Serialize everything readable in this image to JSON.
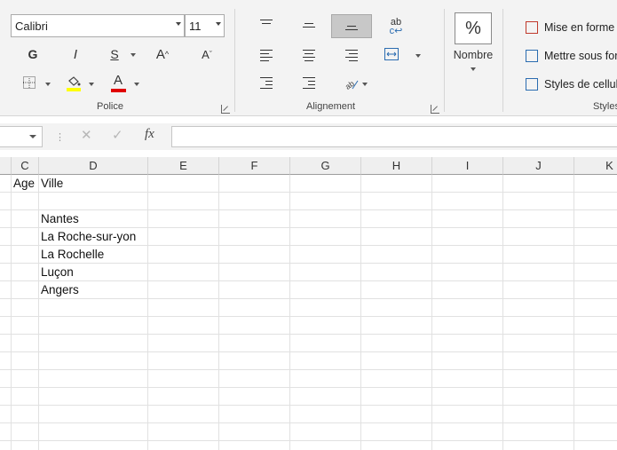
{
  "ribbon": {
    "font": {
      "name": "Calibri",
      "size": "11"
    },
    "police": {
      "group_label": "Police",
      "bold": "G",
      "italic": "I",
      "underline": "S",
      "grow": "A",
      "shrink": "A",
      "font_color_letter": "A",
      "highlight_color": "#ffff00",
      "font_color": "#e00000"
    },
    "alignment": {
      "group_label": "Alignement",
      "wrap_glyph": "ab"
    },
    "number": {
      "percent": "%",
      "label": "Nombre"
    },
    "styles": {
      "conditional": "Mise en forme",
      "as_table": "Mettre sous for",
      "cell_styles": "Styles de cellule",
      "group_label": "Styles"
    }
  },
  "formula_bar": {
    "cancel": "✕",
    "enter": "✓",
    "fx": "fx",
    "content": ""
  },
  "columns": [
    "C",
    "D",
    "E",
    "F",
    "G",
    "H",
    "I",
    "J",
    "K"
  ],
  "cells": {
    "c1": "Age",
    "d1": "Ville",
    "cities": [
      "Nantes",
      "La Roche-sur-yon",
      "La Rochelle",
      "Luçon",
      "Angers"
    ]
  }
}
